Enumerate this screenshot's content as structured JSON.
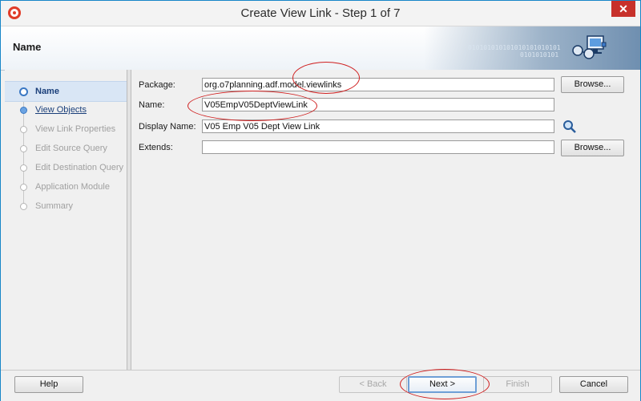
{
  "window": {
    "title": "Create View Link - Step 1 of 7",
    "close_glyph": "✕"
  },
  "header": {
    "title": "Name",
    "binary_1": "010101010101010101010101",
    "binary_2": "0101010101"
  },
  "nav": {
    "items": [
      {
        "label": "Name",
        "state": "active"
      },
      {
        "label": "View Objects",
        "state": "link"
      },
      {
        "label": "View Link Properties",
        "state": "disabled"
      },
      {
        "label": "Edit Source Query",
        "state": "disabled"
      },
      {
        "label": "Edit Destination Query",
        "state": "disabled"
      },
      {
        "label": "Application Module",
        "state": "disabled"
      },
      {
        "label": "Summary",
        "state": "disabled"
      }
    ]
  },
  "form": {
    "package": {
      "label": "Package:",
      "value": "org.o7planning.adf.model.viewlinks"
    },
    "name": {
      "label": "Name:",
      "value": "V05EmpV05DeptViewLink"
    },
    "display_name": {
      "label": "Display Name:",
      "value": "V05 Emp V05 Dept View Link"
    },
    "extends": {
      "label": "Extends:",
      "value": ""
    },
    "browse_label": "Browse..."
  },
  "buttons": {
    "help": "Help",
    "back": "< Back",
    "next": "Next >",
    "finish": "Finish",
    "cancel": "Cancel"
  },
  "colors": {
    "annotation": "#cf1f1f",
    "accent": "#3a78c3"
  }
}
